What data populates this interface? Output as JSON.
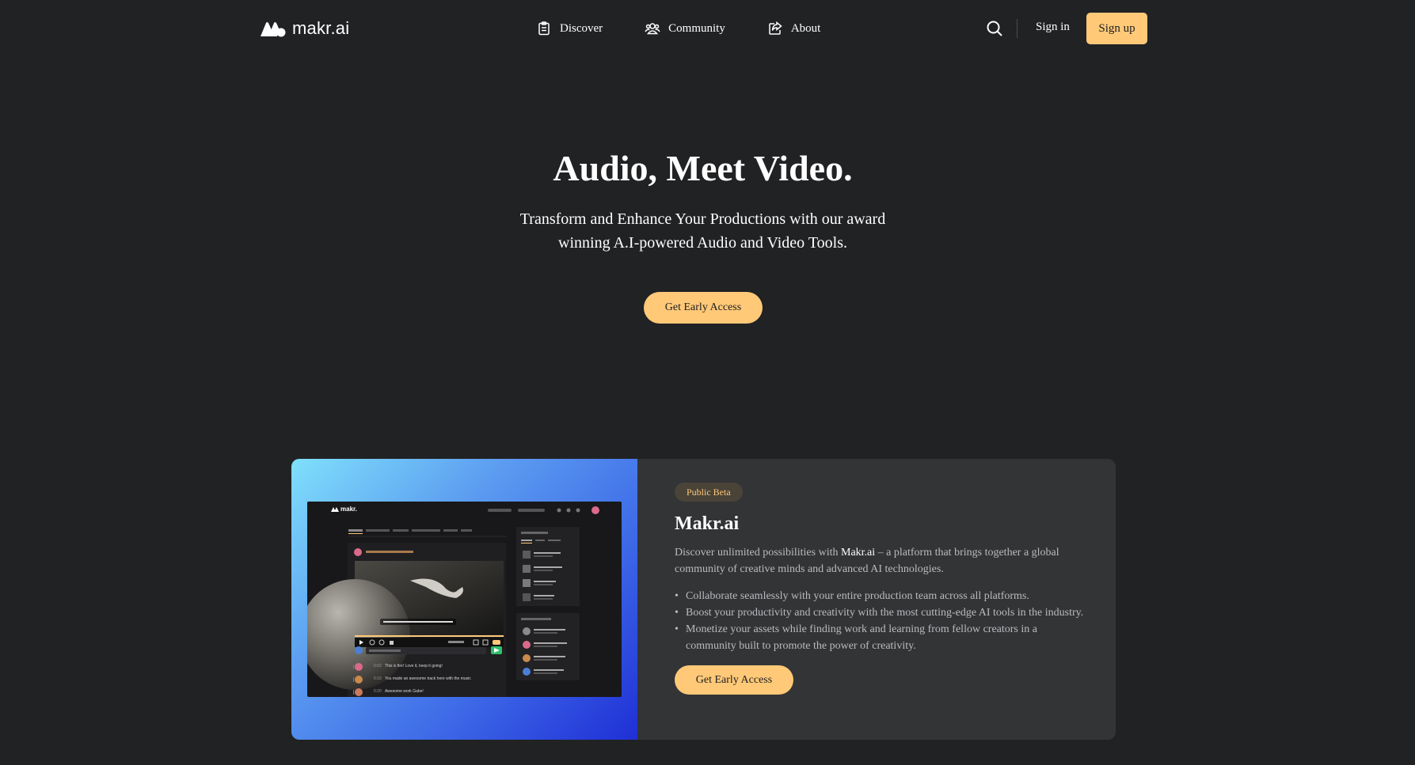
{
  "brand": {
    "name": "makr.ai",
    "logo_icon": "makr-logo-icon"
  },
  "nav": {
    "links": [
      {
        "label": "Discover",
        "icon": "clipboard-icon"
      },
      {
        "label": "Community",
        "icon": "users-icon"
      },
      {
        "label": "About",
        "icon": "share-icon"
      }
    ],
    "search_icon": "search-icon",
    "sign_in": "Sign in",
    "sign_up": "Sign up"
  },
  "hero": {
    "title": "Audio, Meet Video.",
    "subtitle": "Transform and Enhance Your Productions with our award winning A.I-powered Audio and Video Tools.",
    "cta": "Get Early Access"
  },
  "feature": {
    "badge": "Public Beta",
    "title": "Makr.ai",
    "desc_prefix": "Discover unlimited possibilities with ",
    "desc_brand": "Makr.ai",
    "desc_suffix": " – a platform that brings together a global community of creative minds and advanced AI technologies.",
    "bullets": [
      "Collaborate seamlessly with your entire production team across all platforms.",
      "Boost your productivity and creativity with the most cutting-edge AI tools in the industry.",
      "Monetize your assets while finding work and learning from fellow creators in a community built to promote the power of creativity."
    ],
    "cta": "Get Early Access",
    "mockup": {
      "logo": "makr.",
      "comments": [
        {
          "time": "0:02",
          "text": "This is fire! Love it, keep it going!"
        },
        {
          "time": "0:10",
          "text": "You made an awesome track here with the music"
        },
        {
          "time": "0:20",
          "text": "Awesome work Gabe!"
        }
      ]
    }
  },
  "colors": {
    "background": "#212224",
    "accent": "#ffc978",
    "card": "#333436"
  }
}
